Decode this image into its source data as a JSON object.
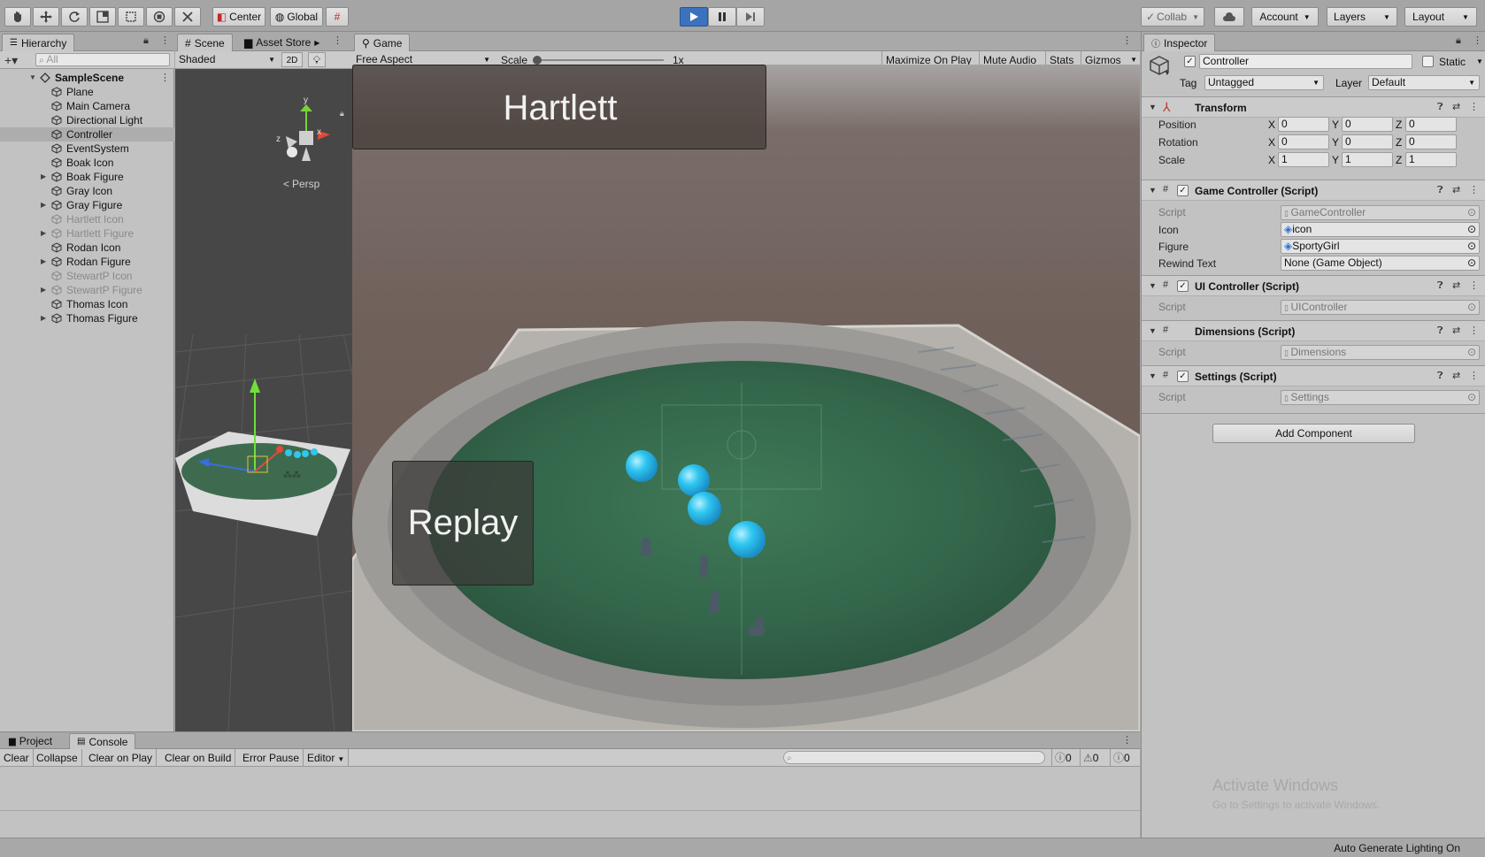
{
  "toolbar": {
    "tools": [
      "hand-tool-icon",
      "move-tool-icon",
      "rotate-tool-icon",
      "scale-tool-icon",
      "rect-tool-icon",
      "transform-tool-icon",
      "custom-tool-icon"
    ],
    "pivot_label": "Center",
    "space_label": "Global",
    "collab_label": "Collab",
    "account_label": "Account",
    "layers_label": "Layers",
    "layout_label": "Layout"
  },
  "hierarchy": {
    "tab": "Hierarchy",
    "search_placeholder": "All",
    "scene_name": "SampleScene",
    "items": [
      {
        "label": "Plane",
        "expandable": false,
        "dim": false,
        "selected": false
      },
      {
        "label": "Main Camera",
        "expandable": false,
        "dim": false,
        "selected": false
      },
      {
        "label": "Directional Light",
        "expandable": false,
        "dim": false,
        "selected": false
      },
      {
        "label": "Controller",
        "expandable": false,
        "dim": false,
        "selected": true
      },
      {
        "label": "EventSystem",
        "expandable": false,
        "dim": false,
        "selected": false
      },
      {
        "label": "Boak Icon",
        "expandable": false,
        "dim": false,
        "selected": false
      },
      {
        "label": "Boak Figure",
        "expandable": true,
        "dim": false,
        "selected": false
      },
      {
        "label": "Gray Icon",
        "expandable": false,
        "dim": false,
        "selected": false
      },
      {
        "label": "Gray Figure",
        "expandable": true,
        "dim": false,
        "selected": false
      },
      {
        "label": "Hartlett Icon",
        "expandable": false,
        "dim": true,
        "selected": false
      },
      {
        "label": "Hartlett Figure",
        "expandable": true,
        "dim": true,
        "selected": false
      },
      {
        "label": "Rodan Icon",
        "expandable": false,
        "dim": false,
        "selected": false
      },
      {
        "label": "Rodan Figure",
        "expandable": true,
        "dim": false,
        "selected": false
      },
      {
        "label": "StewartP Icon",
        "expandable": false,
        "dim": true,
        "selected": false
      },
      {
        "label": "StewartP Figure",
        "expandable": true,
        "dim": true,
        "selected": false
      },
      {
        "label": "Thomas Icon",
        "expandable": false,
        "dim": false,
        "selected": false
      },
      {
        "label": "Thomas Figure",
        "expandable": true,
        "dim": false,
        "selected": false
      }
    ]
  },
  "scene": {
    "tab": "Scene",
    "asset_store_tab": "Asset Store",
    "shading": "Shaded",
    "mode_2d": "2D",
    "persp_label": "Persp",
    "gizmo_axes": [
      "y",
      "x",
      "z"
    ]
  },
  "game": {
    "tab": "Game",
    "aspect": "Free Aspect",
    "scale_label": "Scale",
    "scale_value": "1x",
    "maximize": "Maximize On Play",
    "mute": "Mute Audio",
    "stats": "Stats",
    "gizmos": "Gizmos",
    "title_text": "Hartlett",
    "replay_text": "Replay"
  },
  "inspector": {
    "tab": "Inspector",
    "object_name": "Controller",
    "static_label": "Static",
    "tag_label": "Tag",
    "tag_value": "Untagged",
    "layer_label": "Layer",
    "layer_value": "Default",
    "transform": {
      "title": "Transform",
      "rows": [
        {
          "label": "Position",
          "x": "0",
          "y": "0",
          "z": "0"
        },
        {
          "label": "Rotation",
          "x": "0",
          "y": "0",
          "z": "0"
        },
        {
          "label": "Scale",
          "x": "1",
          "y": "1",
          "z": "1"
        }
      ]
    },
    "axis_x": "X",
    "axis_y": "Y",
    "axis_z": "Z",
    "game_controller": {
      "title": "Game Controller (Script)",
      "script_label": "Script",
      "script_value": "GameController",
      "icon_label": "Icon",
      "icon_value": "icon",
      "figure_label": "Figure",
      "figure_value": "SportyGirl",
      "rewind_label": "Rewind Text",
      "rewind_value": "None (Game Object)"
    },
    "ui_controller": {
      "title": "UI Controller (Script)",
      "script_label": "Script",
      "script_value": "UIController"
    },
    "dimensions": {
      "title": "Dimensions (Script)",
      "script_label": "Script",
      "script_value": "Dimensions"
    },
    "settings": {
      "title": "Settings (Script)",
      "script_label": "Script",
      "script_value": "Settings"
    },
    "add_component": "Add Component",
    "watermark_1": "Activate Windows",
    "watermark_2": "Go to Settings to activate Windows."
  },
  "console": {
    "project_tab": "Project",
    "console_tab": "Console",
    "buttons": [
      "Clear",
      "Collapse",
      "Clear on Play",
      "Clear on Build",
      "Error Pause"
    ],
    "editor_label": "Editor",
    "info_count": "0",
    "warning_count": "0",
    "error_count": "0"
  },
  "status": {
    "text": "Auto Generate Lighting On"
  },
  "colors": {
    "play_active": "#3a72c0",
    "sphere": "#2fc6f0",
    "panel_bg": "#c2c2c2"
  }
}
